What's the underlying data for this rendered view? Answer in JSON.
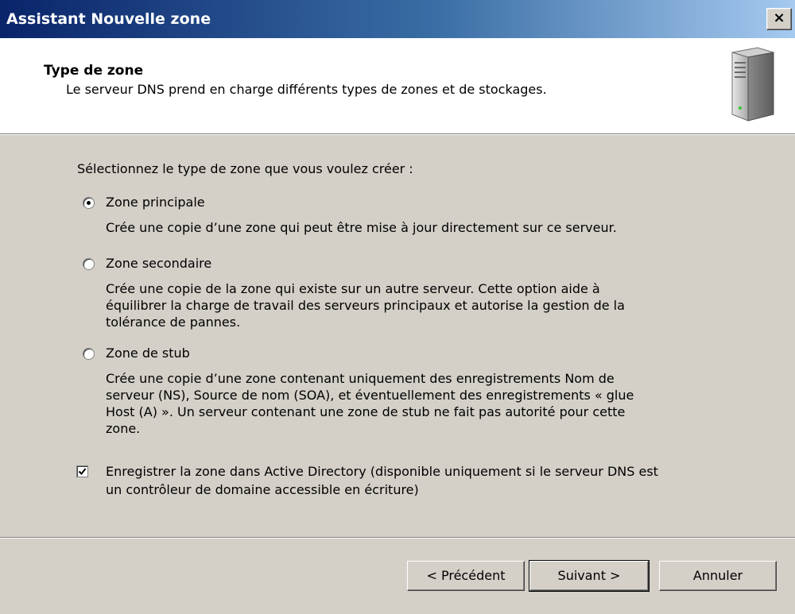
{
  "window": {
    "title": "Assistant Nouvelle zone",
    "close_label": "×"
  },
  "header": {
    "title": "Type de zone",
    "description": "Le serveur DNS prend en charge différents types de zones et de stockages.",
    "icon": "server-icon"
  },
  "body": {
    "prompt": "Sélectionnez le type de zone que vous voulez créer :",
    "options": [
      {
        "label": "Zone principale",
        "selected": true,
        "description_lines": [
          "Crée une copie d’une zone qui peut être mise à jour directement sur ce serveur."
        ]
      },
      {
        "label": "Zone secondaire",
        "selected": false,
        "description_lines": [
          "Crée une copie de la zone qui existe sur un autre serveur. Cette option aide à",
          "équilibrer la charge de travail des serveurs principaux et autorise la gestion de la",
          "tolérance de pannes."
        ]
      },
      {
        "label": "Zone de stub",
        "selected": false,
        "description_lines": [
          "Crée une copie d’une zone contenant uniquement des enregistrements Nom de",
          "serveur (NS), Source de nom (SOA), et éventuellement des enregistrements « glue",
          "Host (A) ». Un serveur contenant une zone de stub ne fait pas autorité pour cette",
          "zone."
        ]
      }
    ],
    "ad_checkbox": {
      "checked": true,
      "label_lines": [
        "Enregistrer la zone dans Active Directory (disponible uniquement si le serveur DNS est",
        "un contrôleur de domaine accessible en écriture)"
      ]
    }
  },
  "footer": {
    "back_label": "< Précédent",
    "next_label": "Suivant >",
    "cancel_label": "Annuler"
  }
}
